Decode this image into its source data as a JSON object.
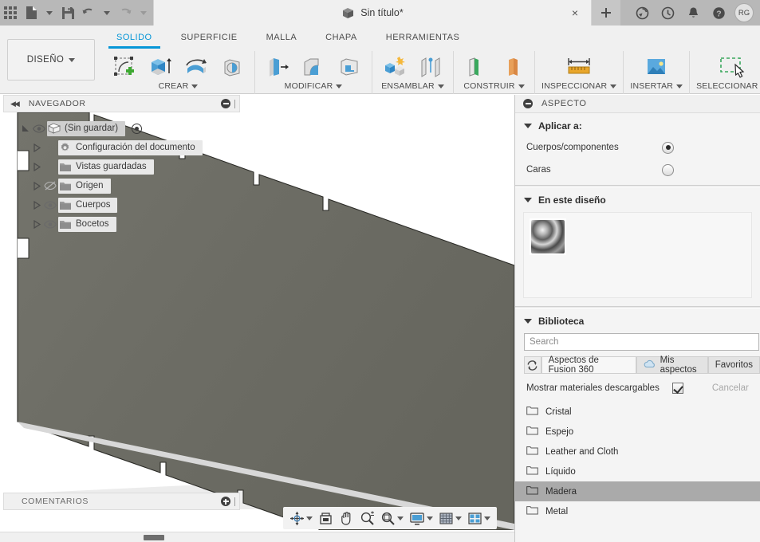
{
  "appbar": {
    "doc_title": "Sin título*",
    "grid_icon": "app-grid-icon",
    "new_icon": "new-document-icon",
    "save_icon": "save-icon",
    "undo_icon": "undo-icon",
    "redo_icon": "redo-icon",
    "close_tab": "×",
    "plus_tab": "+",
    "refresh_icon": "sync-icon",
    "recent_icon": "recent-icon",
    "bell_icon": "notifications-icon",
    "help_icon": "help-icon",
    "avatar_initials": "RG"
  },
  "ribbon": {
    "workspace": "DISEÑO",
    "tabs": [
      {
        "label": "SOLIDO",
        "active": true
      },
      {
        "label": "SUPERFICIE",
        "active": false
      },
      {
        "label": "MALLA",
        "active": false
      },
      {
        "label": "CHAPA",
        "active": false
      },
      {
        "label": "HERRAMIENTAS",
        "active": false
      }
    ],
    "panels": [
      {
        "label": "CREAR"
      },
      {
        "label": "MODIFICAR"
      },
      {
        "label": "ENSAMBLAR"
      },
      {
        "label": "CONSTRUIR"
      },
      {
        "label": "INSPECCIONAR"
      },
      {
        "label": "INSERTAR"
      },
      {
        "label": "SELECCIONAR"
      }
    ]
  },
  "navigator": {
    "title": "NAVEGADOR",
    "root": "(Sin guardar)",
    "items": [
      {
        "label": "Configuración del documento",
        "icon": "gear-icon",
        "eye": "none"
      },
      {
        "label": "Vistas guardadas",
        "icon": "folder-icon",
        "eye": "none"
      },
      {
        "label": "Origen",
        "icon": "folder-icon",
        "eye": "hidden"
      },
      {
        "label": "Cuerpos",
        "icon": "folder-icon",
        "eye": "visible"
      },
      {
        "label": "Bocetos",
        "icon": "folder-icon",
        "eye": "visible"
      }
    ],
    "comments": "COMENTARIOS"
  },
  "view_toolbar": {
    "items": [
      {
        "name": "orbit-icon",
        "caret": true
      },
      {
        "name": "look-at-icon",
        "caret": false
      },
      {
        "name": "pan-icon",
        "caret": false
      },
      {
        "name": "zoom-icon",
        "caret": false
      },
      {
        "name": "zoom-window-icon",
        "caret": true
      },
      {
        "name": "display-settings-icon",
        "caret": true
      },
      {
        "name": "grid-snaps-icon",
        "caret": true
      },
      {
        "name": "viewports-icon",
        "caret": true
      }
    ]
  },
  "aspecto": {
    "title": "ASPECTO",
    "apply_to": {
      "heading": "Aplicar a:",
      "options": [
        {
          "label": "Cuerpos/componentes",
          "selected": true
        },
        {
          "label": "Caras",
          "selected": false
        }
      ]
    },
    "in_design": {
      "heading": "En este diseño",
      "swatches": [
        {
          "name": "chrome-material-swatch",
          "color": "#7d7d7d"
        }
      ]
    },
    "library": {
      "heading": "Biblioteca",
      "search_placeholder": "Search",
      "search_value": "",
      "refresh_icon": "refresh-icon",
      "tabs": [
        {
          "label": "Aspectos de Fusion 360",
          "active": true,
          "icon": "none"
        },
        {
          "label": "Mis aspectos",
          "active": false,
          "icon": "cloud-icon"
        },
        {
          "label": "Favoritos",
          "active": false,
          "icon": "none"
        }
      ],
      "show_downloadable_label": "Mostrar materiales descargables",
      "show_downloadable_checked": true,
      "cancel_label": "Cancelar",
      "folders": [
        {
          "label": "Cristal",
          "selected": false
        },
        {
          "label": "Espejo",
          "selected": false
        },
        {
          "label": "Leather and Cloth",
          "selected": false
        },
        {
          "label": "Líquido",
          "selected": false
        },
        {
          "label": "Madera",
          "selected": true
        },
        {
          "label": "Metal",
          "selected": false
        }
      ]
    }
  },
  "colors": {
    "accent": "#0696d7",
    "appbar_bg": "#b8b8b8",
    "ribbon_bg": "#f0f0f0",
    "panel_bg": "#f4f4f4",
    "model_face": "#6e6e66",
    "selection_highlight": "#aaaaaa"
  }
}
